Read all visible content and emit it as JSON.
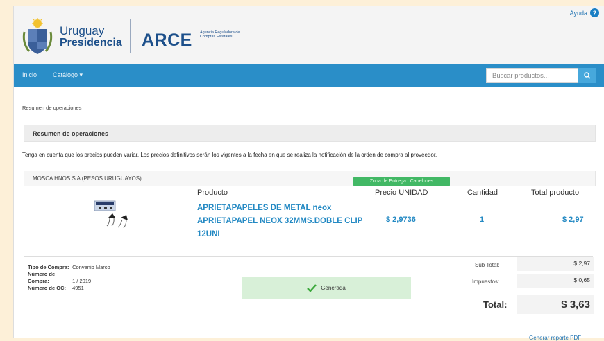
{
  "header": {
    "help_label": "Ayuda",
    "help_icon": "?",
    "logo_line1": "Uruguay",
    "logo_line2": "Presidencia",
    "arce_title": "ARCE",
    "arce_sub": "Agencia Reguladora de Compras Estatales"
  },
  "nav": {
    "home": "Inicio",
    "catalog": "Catálogo ▾",
    "search_placeholder": "Buscar productos..."
  },
  "breadcrumb": "Resumen de operaciones",
  "panel_title": "Resumen de operaciones",
  "notice": "Tenga en cuenta que los precios pueden variar. Los precios definitivos serán los vigentes a la fecha en que se realiza la notificación de la orden de compra al proveedor.",
  "supplier": "MOSCA HNOS S A (PESOS URUGUAYOS)",
  "zona_badge": "Zona de Entrega : Canelones",
  "table": {
    "headers": [
      "Producto",
      "Precio UNIDAD",
      "Cantidad",
      "Total producto"
    ],
    "row": {
      "product": "APRIETAPAPELES DE METAL neox APRIETAPAPEL NEOX 32MMS.DOBLE CLIP 12UNI",
      "unit_price": "$ 2,9736",
      "quantity": "1",
      "total": "$ 2,97"
    }
  },
  "meta": {
    "tipo_label": "Tipo de Compra:",
    "tipo_value": "Convenio Marco",
    "numero_label": "Número de Compra:",
    "numero_value": "1 / 2019",
    "oc_label": "Número de OC:",
    "oc_value": "4951"
  },
  "status": "Generada",
  "totals": {
    "subtotal_label": "Sub Total:",
    "subtotal_value": "$ 2,97",
    "tax_label": "Impuestos:",
    "tax_value": "$ 0,65",
    "total_label": "Total:",
    "total_value": "$ 3,63"
  },
  "pdf_link": "Generar reporte PDF",
  "colors": {
    "nav": "#2a8ec8",
    "brand": "#1c4f8a",
    "link": "#2389c3",
    "badge": "#42b865"
  }
}
